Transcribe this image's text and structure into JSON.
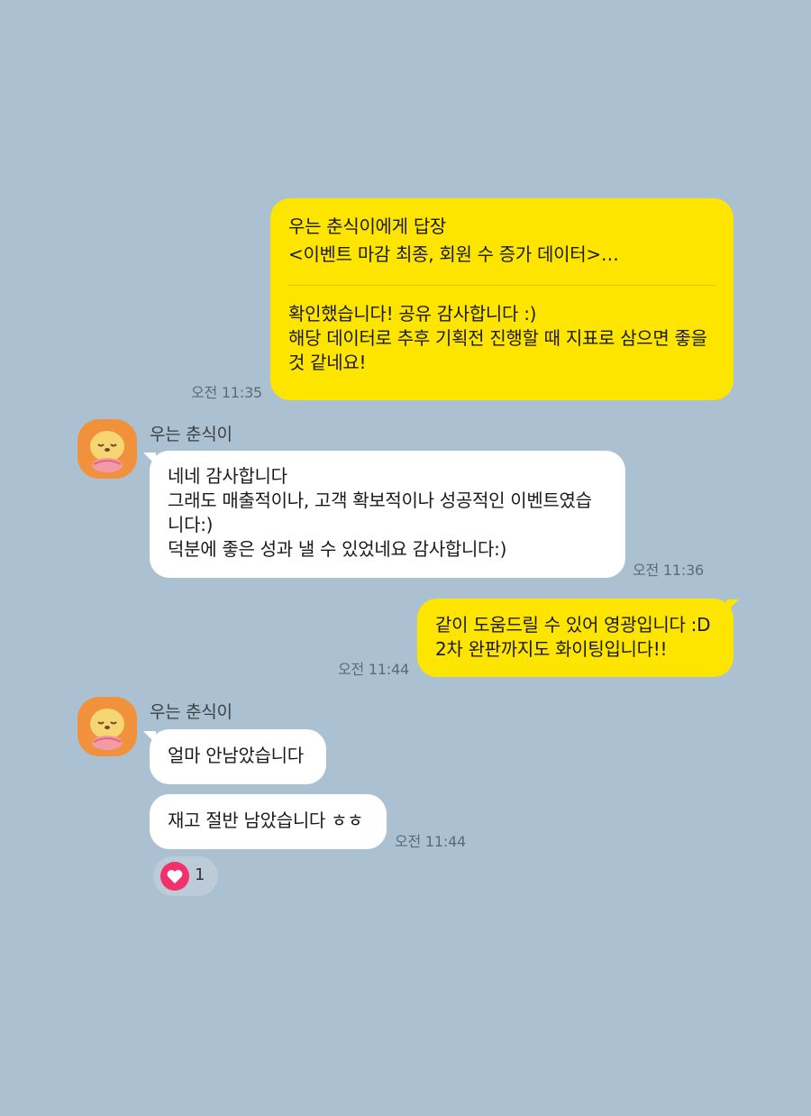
{
  "messages": {
    "m1": {
      "reply_title": "우는 춘식이에게 답장",
      "reply_quote": "<이벤트 마감 최종, 회원 수 증가 데이터>…",
      "lines": [
        "확인했습니다! 공유 감사합니다 :)",
        "해당 데이터로 추후 기획전 진행할 때 지표로 삼으면 좋을",
        "것 같네요!"
      ],
      "time": "오전 11:35"
    },
    "m2": {
      "sender": "우는 춘식이",
      "lines": [
        "네네 감사합니다",
        "그래도 매출적이나, 고객 확보적이나 성공적인 이벤트였습",
        "니다:)",
        "덕분에 좋은 성과 낼 수 있었네요 감사합니다:)"
      ],
      "time": "오전 11:36"
    },
    "m3": {
      "lines": [
        "같이 도움드릴 수 있어 영광입니다 :D",
        "2차 완판까지도 화이팅입니다!!"
      ],
      "time": "오전 11:44"
    },
    "m4": {
      "sender": "우는 춘식이",
      "text1": "얼마 안남았습니다",
      "text2": "재고 절반 남았습니다 ㅎㅎ",
      "time": "오전 11:44",
      "reaction_icon": "heart-icon",
      "reaction_count": "1"
    }
  },
  "colors": {
    "background": "#abc1d1",
    "my_bubble": "#fee500",
    "their_bubble": "#ffffff",
    "reaction_heart": "#f2306b"
  }
}
